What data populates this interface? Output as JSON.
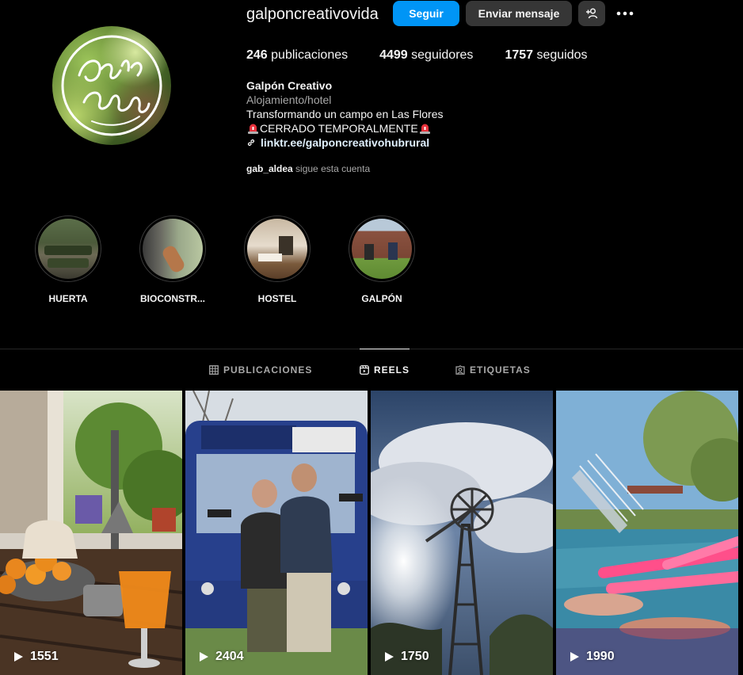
{
  "profile": {
    "username": "galponcreativovida",
    "follow_label": "Seguir",
    "message_label": "Enviar mensaje",
    "stats": {
      "posts_count": "246",
      "posts_label": "publicaciones",
      "followers_count": "4499",
      "followers_label": "seguidores",
      "following_count": "1757",
      "following_label": "seguidos"
    },
    "bio": {
      "name": "Galpón Creativo",
      "category": "Alojamiento/hotel",
      "line1": "Transformando un campo en Las Flores",
      "line2": "CERRADO TEMPORALMENTE",
      "link": "linktr.ee/galponcreativohubrural"
    },
    "followed_by": {
      "name": "gab_aldea",
      "text": "sigue esta cuenta"
    }
  },
  "highlights": [
    {
      "label": "HUERTA"
    },
    {
      "label": "BIOCONSTR..."
    },
    {
      "label": "HOSTEL"
    },
    {
      "label": "GALPÓN"
    }
  ],
  "tabs": [
    {
      "label": "PUBLICACIONES",
      "icon": "grid-icon",
      "active": false
    },
    {
      "label": "REELS",
      "icon": "reels-icon",
      "active": true
    },
    {
      "label": "ETIQUETAS",
      "icon": "tagged-icon",
      "active": false
    }
  ],
  "reels": [
    {
      "views": "1551",
      "subject": "orange-juice-table"
    },
    {
      "views": "2404",
      "subject": "bus-343-couple"
    },
    {
      "views": "1750",
      "subject": "windmill-sky"
    },
    {
      "views": "1990",
      "subject": "pool-floats"
    }
  ],
  "colors": {
    "background": "#000000",
    "primary_button": "#0095f6",
    "secondary_button": "#363636",
    "text_secondary": "#a8a8a8",
    "link": "#e0f1ff"
  }
}
